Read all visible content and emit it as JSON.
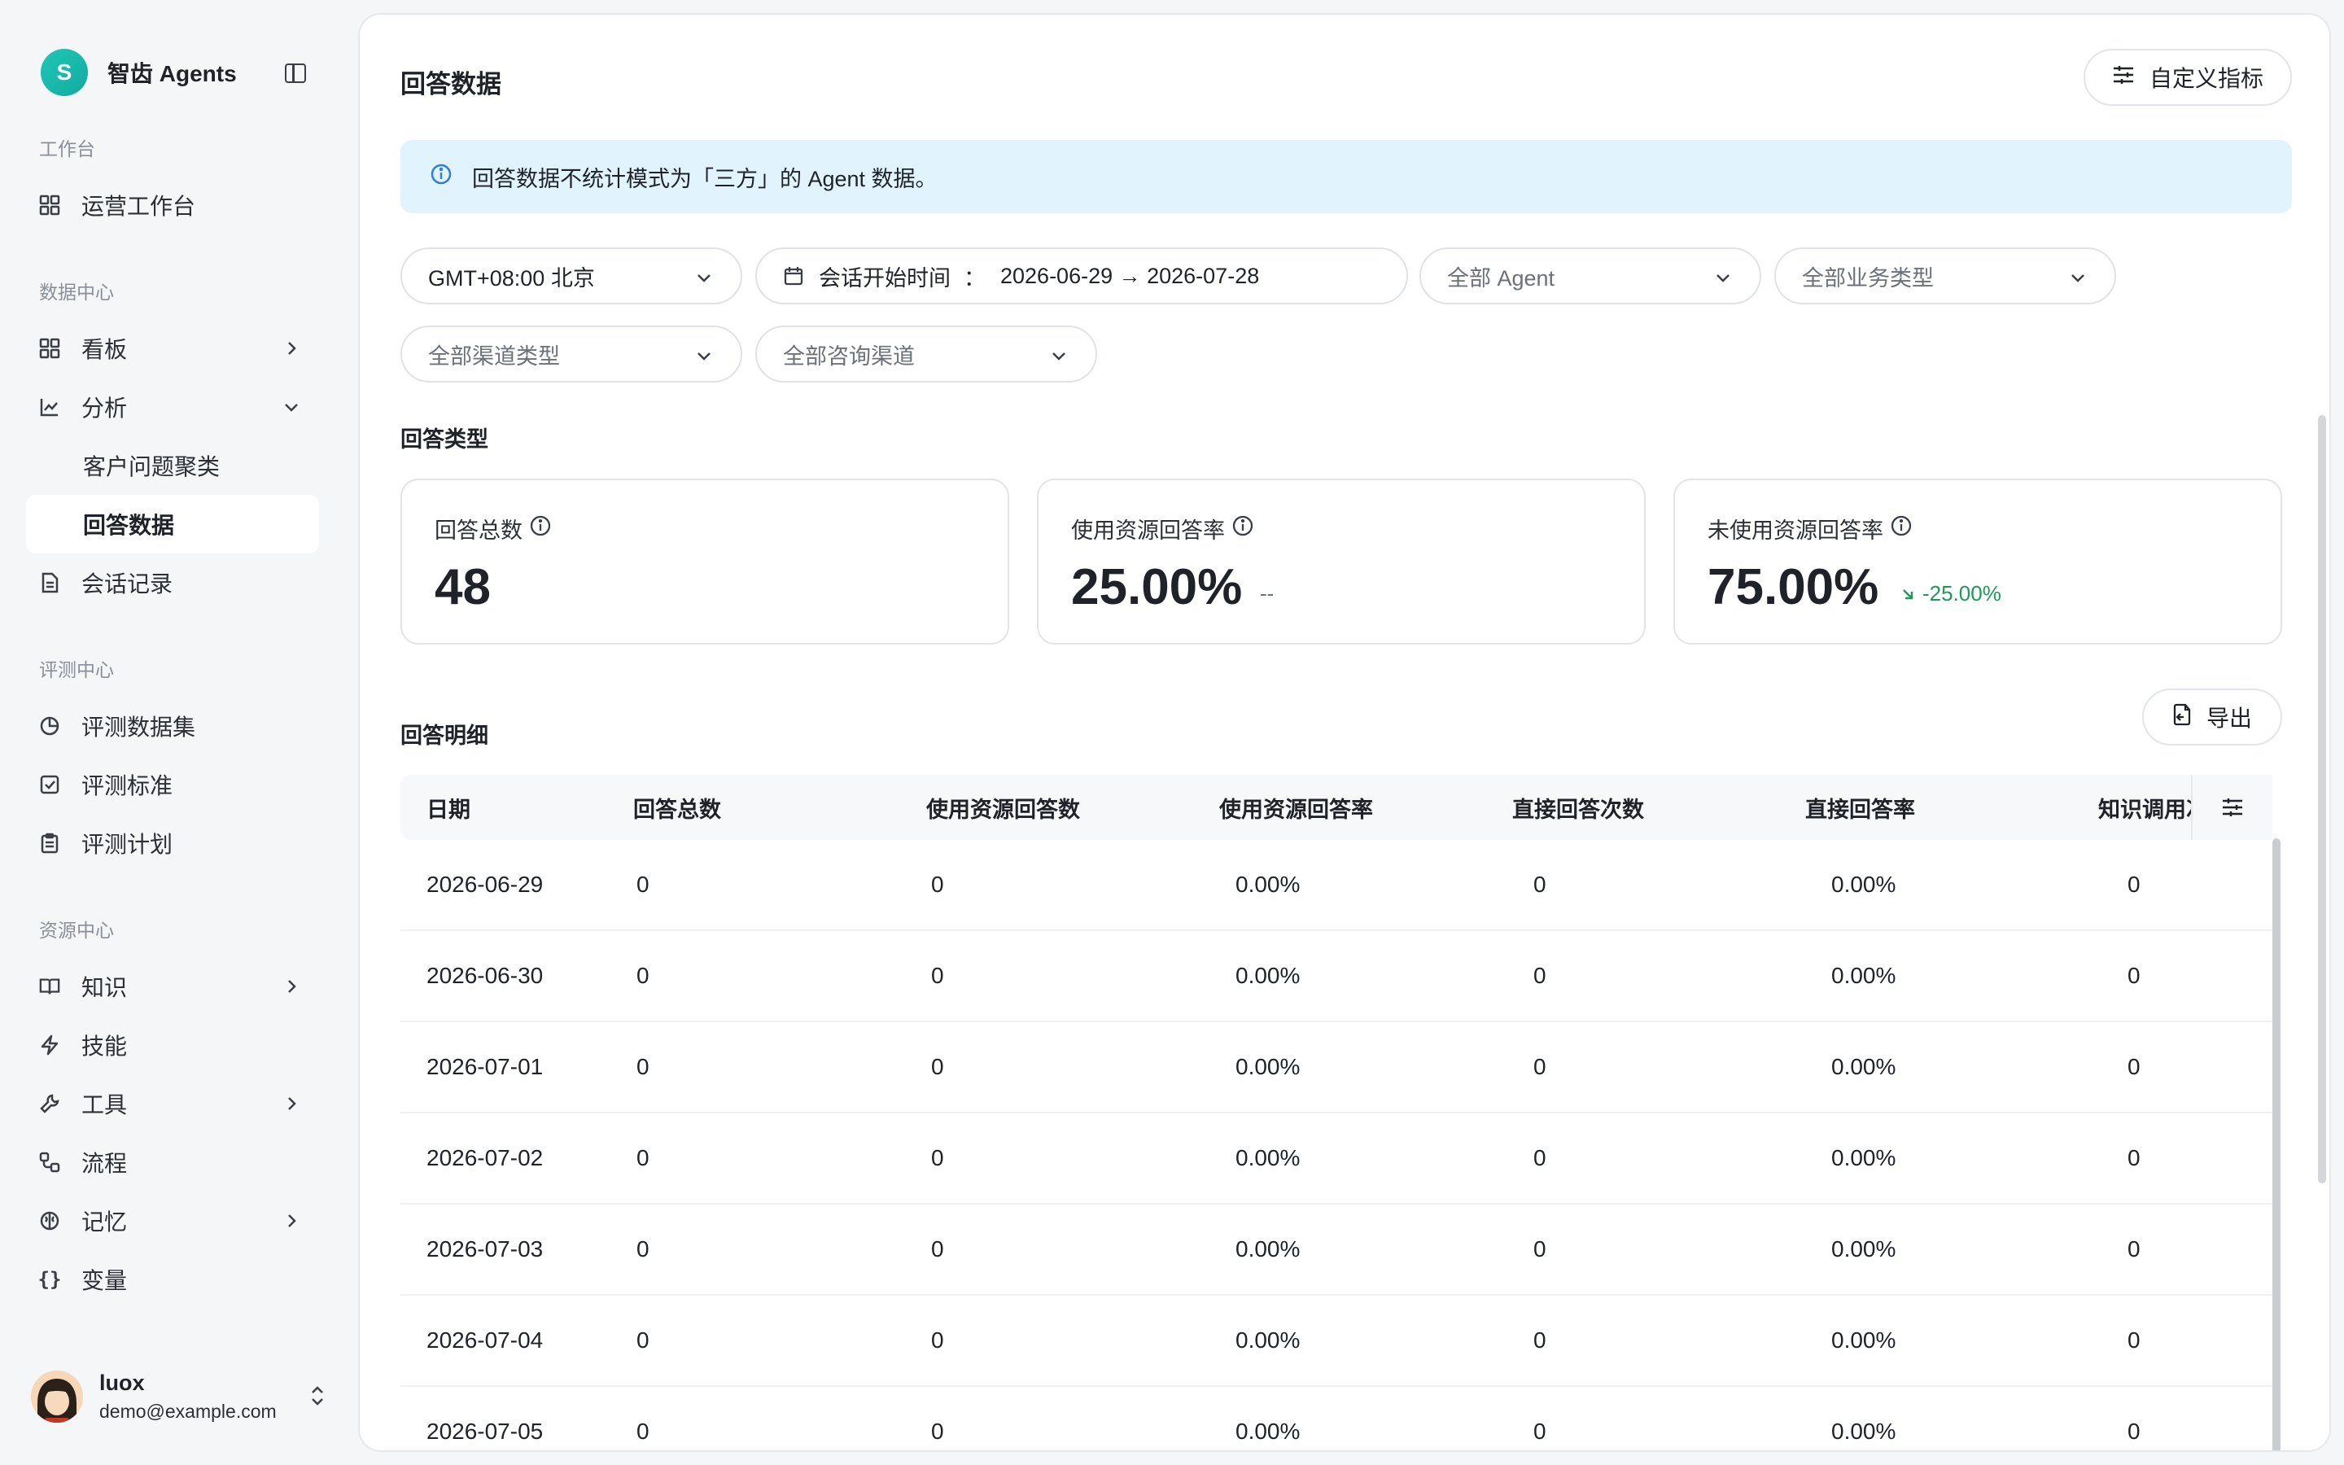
{
  "brand": {
    "logo_letter": "S",
    "name": "智齿 Agents"
  },
  "sidebar": {
    "sections": [
      {
        "title": "工作台",
        "items": [
          {
            "label": "运营工作台",
            "icon": "dashboard-icon"
          }
        ]
      },
      {
        "title": "数据中心",
        "items": [
          {
            "label": "看板",
            "icon": "board-icon"
          },
          {
            "label": "分析",
            "icon": "chart-line-icon"
          },
          {
            "label": "客户问题聚类"
          },
          {
            "label": "回答数据"
          },
          {
            "label": "会话记录",
            "icon": "document-icon"
          }
        ]
      },
      {
        "title": "评测中心",
        "items": [
          {
            "label": "评测数据集",
            "icon": "pie-icon"
          },
          {
            "label": "评测标准",
            "icon": "checkbox-icon"
          },
          {
            "label": "评测计划",
            "icon": "clipboard-icon"
          }
        ]
      },
      {
        "title": "资源中心",
        "items": [
          {
            "label": "知识",
            "icon": "book-icon"
          },
          {
            "label": "技能",
            "icon": "bolt-icon"
          },
          {
            "label": "工具",
            "icon": "wrench-icon"
          },
          {
            "label": "流程",
            "icon": "flow-icon"
          },
          {
            "label": "记忆",
            "icon": "brain-icon"
          },
          {
            "label": "变量",
            "icon": "braces-icon"
          }
        ]
      }
    ],
    "user": {
      "name": "luox",
      "email": "demo@example.com"
    }
  },
  "main": {
    "title": "回答数据",
    "custom_metrics_label": "自定义指标",
    "notice": "回答数据不统计模式为「三方」的 Agent 数据。",
    "filters": {
      "timezone": "GMT+08:00 北京",
      "date_label": "会话开始时间",
      "date_sep": "：",
      "date_range": "2026-06-29 → 2026-07-28",
      "agent": "全部 Agent",
      "business_type": "全部业务类型",
      "channel_type": "全部渠道类型",
      "consult_channel": "全部咨询渠道"
    },
    "answer_type_title": "回答类型",
    "cards": [
      {
        "label": "回答总数",
        "value": "48",
        "delta": ""
      },
      {
        "label": "使用资源回答率",
        "value": "25.00%",
        "delta": "--"
      },
      {
        "label": "未使用资源回答率",
        "value": "75.00%",
        "delta": "-25.00%"
      }
    ],
    "colors": {
      "delta_down": "#1a9b58",
      "accent": "#14b8a6"
    },
    "detail_title": "回答明细",
    "export_label": "导出",
    "table": {
      "columns": [
        "日期",
        "回答总数",
        "使用资源回答数",
        "使用资源回答率",
        "直接回答次数",
        "直接回答率",
        "知识调用次数"
      ],
      "rows": [
        [
          "2026-06-29",
          "0",
          "0",
          "0.00%",
          "0",
          "0.00%",
          "0"
        ],
        [
          "2026-06-30",
          "0",
          "0",
          "0.00%",
          "0",
          "0.00%",
          "0"
        ],
        [
          "2026-07-01",
          "0",
          "0",
          "0.00%",
          "0",
          "0.00%",
          "0"
        ],
        [
          "2026-07-02",
          "0",
          "0",
          "0.00%",
          "0",
          "0.00%",
          "0"
        ],
        [
          "2026-07-03",
          "0",
          "0",
          "0.00%",
          "0",
          "0.00%",
          "0"
        ],
        [
          "2026-07-04",
          "0",
          "0",
          "0.00%",
          "0",
          "0.00%",
          "0"
        ],
        [
          "2026-07-05",
          "0",
          "0",
          "0.00%",
          "0",
          "0.00%",
          "0"
        ]
      ]
    }
  }
}
